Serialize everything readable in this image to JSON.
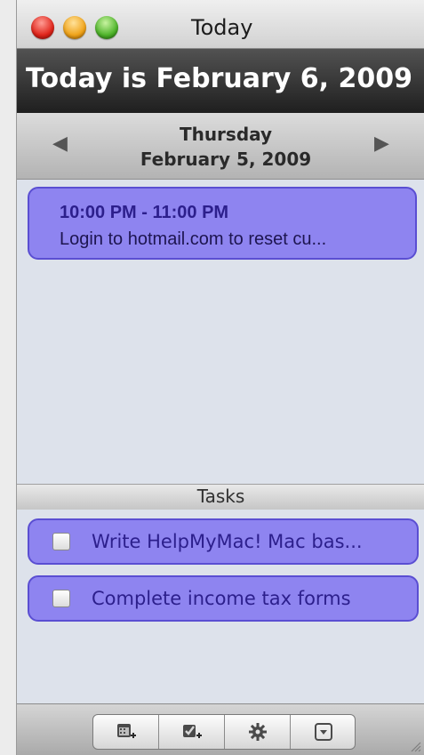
{
  "window": {
    "title": "Today"
  },
  "banner": {
    "text": "Today is February 6, 2009"
  },
  "date_nav": {
    "prev_icon": "left-triangle-icon",
    "next_icon": "right-triangle-icon",
    "day": "Thursday",
    "date": "February 5, 2009"
  },
  "events": [
    {
      "time": "10:00 PM - 11:00 PM",
      "description": "Login to hotmail.com to reset cu..."
    }
  ],
  "tasks": {
    "header": "Tasks",
    "items": [
      {
        "label": "Write HelpMyMac! Mac bas...",
        "checked": false
      },
      {
        "label": "Complete income tax forms",
        "checked": false
      }
    ]
  },
  "toolbar": {
    "buttons": [
      {
        "icon": "new-event-icon"
      },
      {
        "icon": "new-task-icon"
      },
      {
        "icon": "gear-icon"
      },
      {
        "icon": "dropdown-menu-icon"
      }
    ]
  },
  "colors": {
    "card_fill": "#8e84f0",
    "card_border": "#5a4ed2",
    "card_text": "#2c1f8c",
    "banner_bg": "#2a2a2a"
  }
}
